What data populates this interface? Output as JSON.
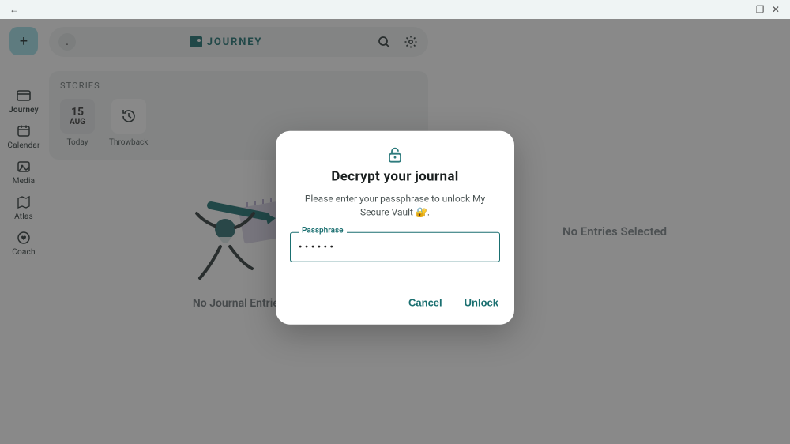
{
  "titlebar": {
    "back": "←",
    "minimize": "—",
    "maximize": "❐",
    "close": "✕"
  },
  "brand": {
    "name": "JOURNEY"
  },
  "avatar_initial": ".",
  "rails": {
    "add": "+",
    "items": [
      {
        "label": "Journey",
        "active": true
      },
      {
        "label": "Calendar"
      },
      {
        "label": "Media"
      },
      {
        "label": "Atlas"
      },
      {
        "label": "Coach"
      }
    ]
  },
  "stories": {
    "title": "STORIES",
    "today": {
      "day": "15",
      "month": "AUG",
      "caption": "Today"
    },
    "throwback": {
      "caption": "Throwback"
    }
  },
  "empty_state": "No Journal Entries",
  "right_panel": "No Entries Selected",
  "dialog": {
    "title": "Decrypt your journal",
    "body": "Please enter your passphrase to unlock My Secure Vault 🔐.",
    "field_label": "Passphrase",
    "pw_dots": "••••••",
    "cancel": "Cancel",
    "unlock": "Unlock"
  }
}
